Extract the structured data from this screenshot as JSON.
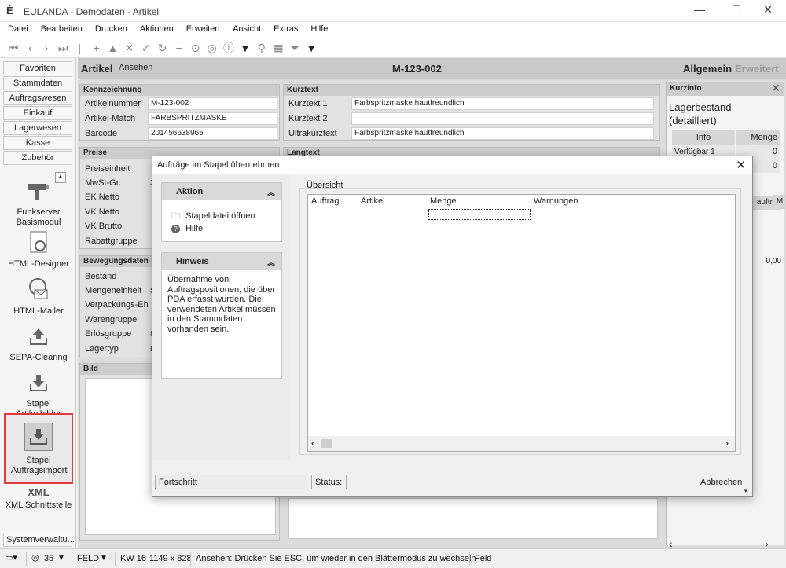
{
  "window": {
    "title": "EULANDA - Demodaten - Artikel",
    "logo": "É"
  },
  "menu": [
    "Datei",
    "Bearbeiten",
    "Drucken",
    "Aktionen",
    "Erweitert",
    "Ansicht",
    "Extras",
    "Hilfe"
  ],
  "sidebar": {
    "tabs": [
      "Favoriten",
      "Stammdaten",
      "Auftragswesen",
      "Einkauf",
      "Lagerwesen",
      "Kasse",
      "Zubehör"
    ],
    "modules": [
      {
        "label": "Funkserver Basismodul"
      },
      {
        "label": "HTML-Designer"
      },
      {
        "label": "HTML-Mailer"
      },
      {
        "label": "SEPA-Clearing"
      },
      {
        "label": "Stapel Artikelbilder"
      },
      {
        "label": "Stapel Auftragsimport"
      },
      {
        "label": "XML Schnittstelle"
      }
    ],
    "bottom_tab": "Systemverwaltu..."
  },
  "main": {
    "header": {
      "title": "Artikel",
      "mode": "Ansehen",
      "record": "M-123-002",
      "tab_general": "Allgemein",
      "tab_extended": "Erweitert"
    },
    "kennzeichnung": {
      "title": "Kennzeichnung",
      "artikelnummer_label": "Artikelnummer",
      "artikelnummer": "M-123-002",
      "match_label": "Artikel-Match",
      "match": "FARBSPRITZMASKE",
      "barcode_label": "Barcode",
      "barcode": "201456638965"
    },
    "kurztext": {
      "title": "Kurztext",
      "k1_label": "Kurztext 1",
      "k1": "Farbspritzmaske hautfreundlich",
      "k2_label": "Kurztext 2",
      "k2": "",
      "ultra_label": "Ultrakurztext",
      "ultra": "Farbspritzmaske hautfreundlich"
    },
    "preise": {
      "title": "Preise",
      "labels": [
        "Preiseinheit",
        "MwSt-Gr.",
        "EK Netto",
        "VK Netto",
        "VK Brutto",
        "Rabattgruppe"
      ],
      "mwst_partial": "3"
    },
    "bewegung": {
      "title": "Bewegungsdaten",
      "labels": [
        "Bestand",
        "Mengeneinheit",
        "Verpackungs-Eh",
        "Warengruppe",
        "Erlösgruppe",
        "Lagertyp"
      ],
      "partials": [
        "",
        "S",
        "",
        "",
        "8",
        "L"
      ]
    },
    "bild": {
      "title": "Bild"
    },
    "langtext_partial": "Langtext"
  },
  "kurzinfo": {
    "title": "Kurzinfo",
    "lager_title": "Lagerbestand (detailliert)",
    "col_info": "Info",
    "col_menge": "Menge",
    "row1_label": "Verfügbar 1",
    "row1_val": "0",
    "row2_val": "0",
    "col3": "auftrag",
    "col4": "M",
    "val3": "0,00"
  },
  "dialog": {
    "title": "Aufträge im Stapel übernehmen",
    "aktion": {
      "title": "Aktion",
      "items": [
        "Stapeldatei öffnen",
        "Hilfe"
      ]
    },
    "hinweis": {
      "title": "Hinweis",
      "text": "Übernahme von Auftragspositionen, die über PDA erfasst wurden. Die verwendeten Artikel müssen in den Stammdaten vorhanden sein."
    },
    "overview": {
      "title": "Übersicht",
      "columns": [
        "Auftrag",
        "Artikel",
        "Menge",
        "Warnungen"
      ]
    },
    "progress_label": "Fortschritt",
    "status_label": "Status:",
    "cancel": "Abbrechen"
  },
  "statusbar": {
    "zoom": "35",
    "field_mode": "FELD",
    "week": "KW 16",
    "resolution": "1149 x 828",
    "message": "Ansehen: Drücken Sie ESC, um wieder in den Blättermodus zu wechseln",
    "field": "Feld"
  },
  "colors": {
    "highlight": "#e0393e",
    "accent": "#1a1a1a"
  }
}
